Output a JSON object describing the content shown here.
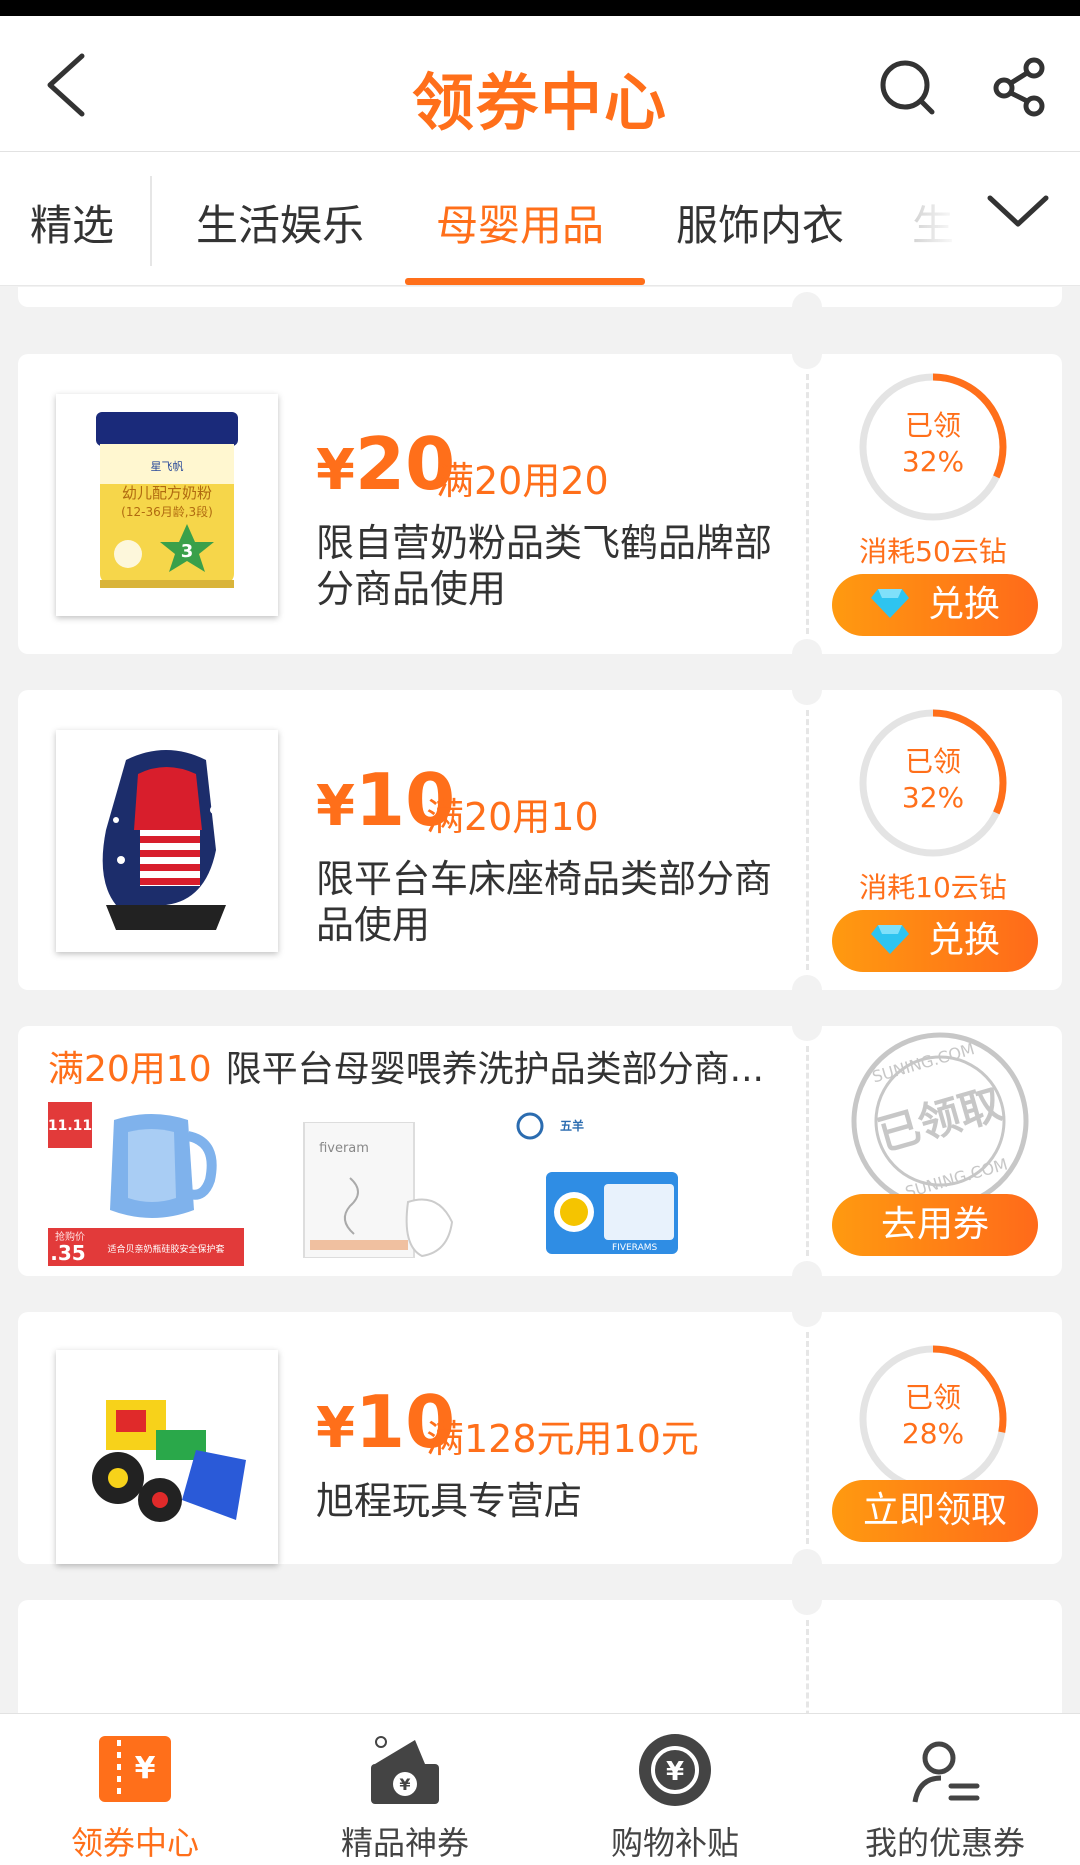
{
  "header": {
    "title": "领券中心"
  },
  "tabs": {
    "items": [
      "精选",
      "生活娱乐",
      "母婴用品",
      "服饰内衣",
      "生"
    ],
    "active": "母婴用品"
  },
  "coupons": [
    {
      "currency": "¥",
      "amount": "20",
      "condition": "满20用20",
      "scope": "限自营奶粉品类飞鹤品牌部分商品使用",
      "claimed_label": "已领",
      "claimed_percent": "32%",
      "claimed_fraction": 0.32,
      "cost": "消耗50云钻",
      "button": "兑换",
      "product_brand": "星飞帆",
      "product_name": "幼儿配方奶粉",
      "product_spec": "(12-36月龄,3段)",
      "product_stage": "3"
    },
    {
      "currency": "¥",
      "amount": "10",
      "condition": "满20用10",
      "scope": "限平台车床座椅品类部分商品使用",
      "claimed_label": "已领",
      "claimed_percent": "32%",
      "claimed_fraction": 0.32,
      "cost": "消耗10云钻",
      "button": "兑换"
    },
    {
      "currency": "¥",
      "amount": "10",
      "condition": "满128元用10元",
      "scope": "旭程玩具专营店",
      "claimed_label": "已领",
      "claimed_percent": "28%",
      "claimed_fraction": 0.28,
      "button": "立即领取"
    }
  ],
  "bundle": {
    "condition": "满20用10",
    "description": "限平台母婴喂养洗护品类部分商...",
    "stamp_text": "已领取",
    "stamp_site": "SUNING.COM",
    "button": "去用券",
    "product1_badge": "11.11",
    "product1_price_label": "抢购价",
    "product1_price": ".35",
    "product1_caption": "适合贝亲奶瓶硅胶安全保护套",
    "product2_brand": "fiveram",
    "product3_brand": "五羊",
    "product3_logo": "FIVERAMS"
  },
  "bottom_nav": [
    {
      "label": "领券中心",
      "icon": "coupon-ticket-icon"
    },
    {
      "label": "精品神券",
      "icon": "premium-coupon-icon"
    },
    {
      "label": "购物补贴",
      "icon": "yen-coin-icon"
    },
    {
      "label": "我的优惠券",
      "icon": "user-coupon-icon"
    }
  ],
  "colors": {
    "accent": "#ff6f1a",
    "ring_track": "#e4e4e4",
    "diamond": "#2ec4f0"
  }
}
